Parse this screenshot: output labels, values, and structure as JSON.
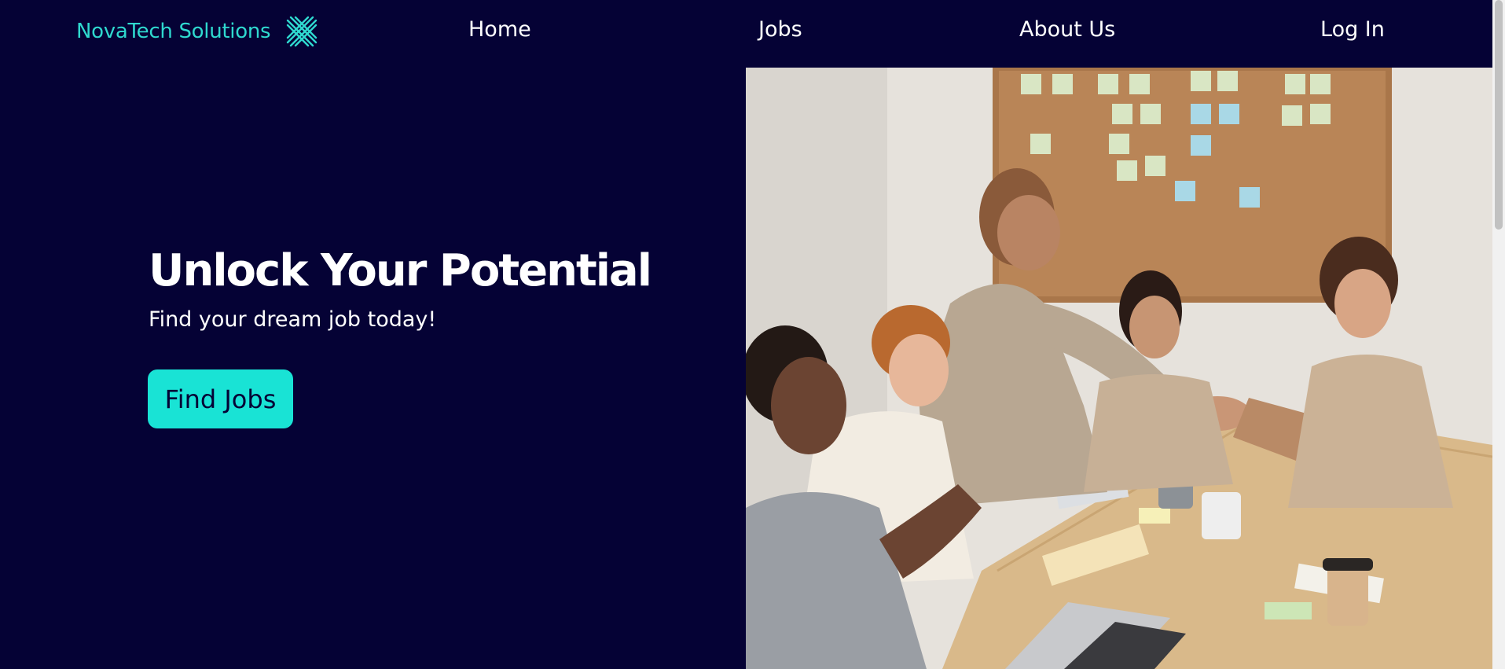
{
  "nav": {
    "brand": "NovaTech Solutions",
    "logo_icon": "crossed-lines-logo",
    "links": [
      {
        "label": "Home"
      },
      {
        "label": "Jobs"
      },
      {
        "label": "About Us"
      },
      {
        "label": "Log In"
      }
    ]
  },
  "hero": {
    "title": "Unlock Your Potential",
    "subtitle": "Find your dream job today!",
    "cta_label": "Find Jobs",
    "image_alt": "team-meeting-handshake-photo"
  },
  "colors": {
    "background": "#050235",
    "accent": "#19e3d5",
    "brand_text": "#2fd9cf",
    "text": "#ffffff"
  }
}
